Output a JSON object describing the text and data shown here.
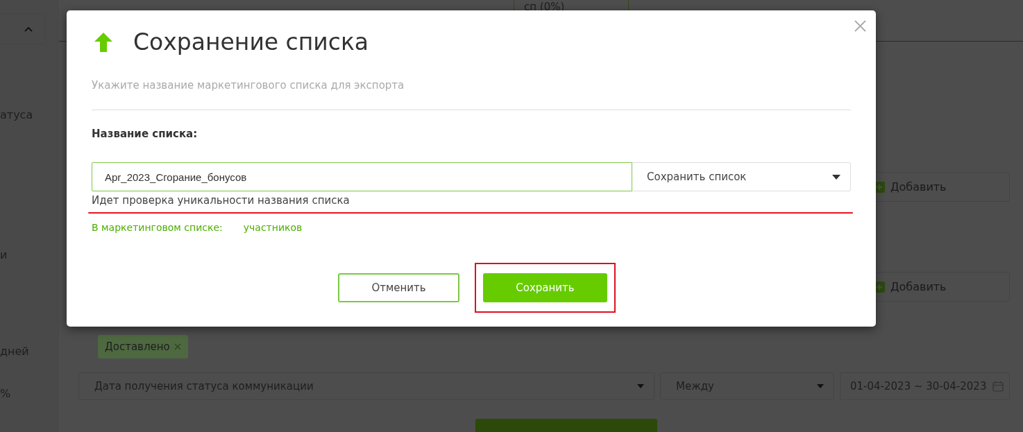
{
  "background": {
    "top_card_label": "сп (0%)",
    "sidebar_labels": [
      "атуса",
      "и",
      "дней",
      "%"
    ],
    "add_buttons": [
      "Добавить",
      "Добавить"
    ],
    "filter_tags": [
      {
        "label": "Доставлено"
      }
    ],
    "filters": [
      {
        "kind": "select",
        "value": "Дата получения статуса коммуникации"
      },
      {
        "kind": "select",
        "value": "Между"
      },
      {
        "kind": "date",
        "value": "01-04-2023 ~ 30-04-2023"
      }
    ]
  },
  "dialog": {
    "title": "Сохранение списка",
    "subtitle": "Укажите название маркетингового списка для экспорта",
    "field_label": "Название списка:",
    "name_input": {
      "value": "Apr_2023_Сгорание_бонусов"
    },
    "mode_select": {
      "value": "Сохранить список"
    },
    "status": {
      "text": "Идет проверка уникальности названия списка",
      "underlined": true
    },
    "count_label": "В маркетинговом списке:",
    "count_unit": "участников",
    "buttons": [
      {
        "label": "Отменить",
        "kind": "secondary",
        "highlighted": false
      },
      {
        "label": "Сохранить",
        "kind": "primary",
        "highlighted": true
      }
    ]
  }
}
